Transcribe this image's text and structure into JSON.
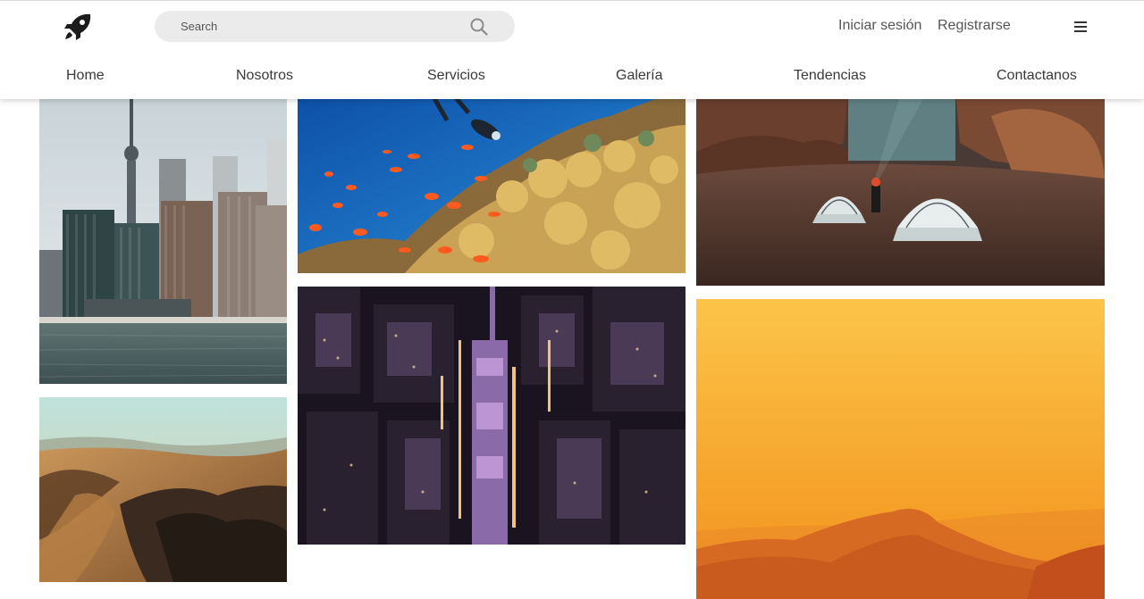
{
  "header": {
    "logo_icon": "rocket-icon",
    "search": {
      "placeholder": "Search",
      "value": "",
      "icon": "search-icon"
    },
    "auth": {
      "login_label": "Iniciar sesión",
      "register_label": "Registrarse"
    },
    "menu_icon": "hamburger-menu-icon"
  },
  "nav": {
    "items": [
      {
        "label": "Home"
      },
      {
        "label": "Nosotros"
      },
      {
        "label": "Servicios"
      },
      {
        "label": "Galería"
      },
      {
        "label": "Tendencias"
      },
      {
        "label": "Contactanos"
      }
    ]
  },
  "gallery": {
    "photos": [
      {
        "subject": "toronto-skyline-cn-tower"
      },
      {
        "subject": "coral-reef-diver"
      },
      {
        "subject": "desert-camp-tents"
      },
      {
        "subject": "desert-canyon-aerial"
      },
      {
        "subject": "night-city-aerial"
      },
      {
        "subject": "orange-sunset-mountains"
      }
    ]
  },
  "colors": {
    "header_bg": "#ffffff",
    "search_bg": "#ebebeb",
    "text": "#3a3a3a",
    "sunset_orange": "#f5a623"
  }
}
